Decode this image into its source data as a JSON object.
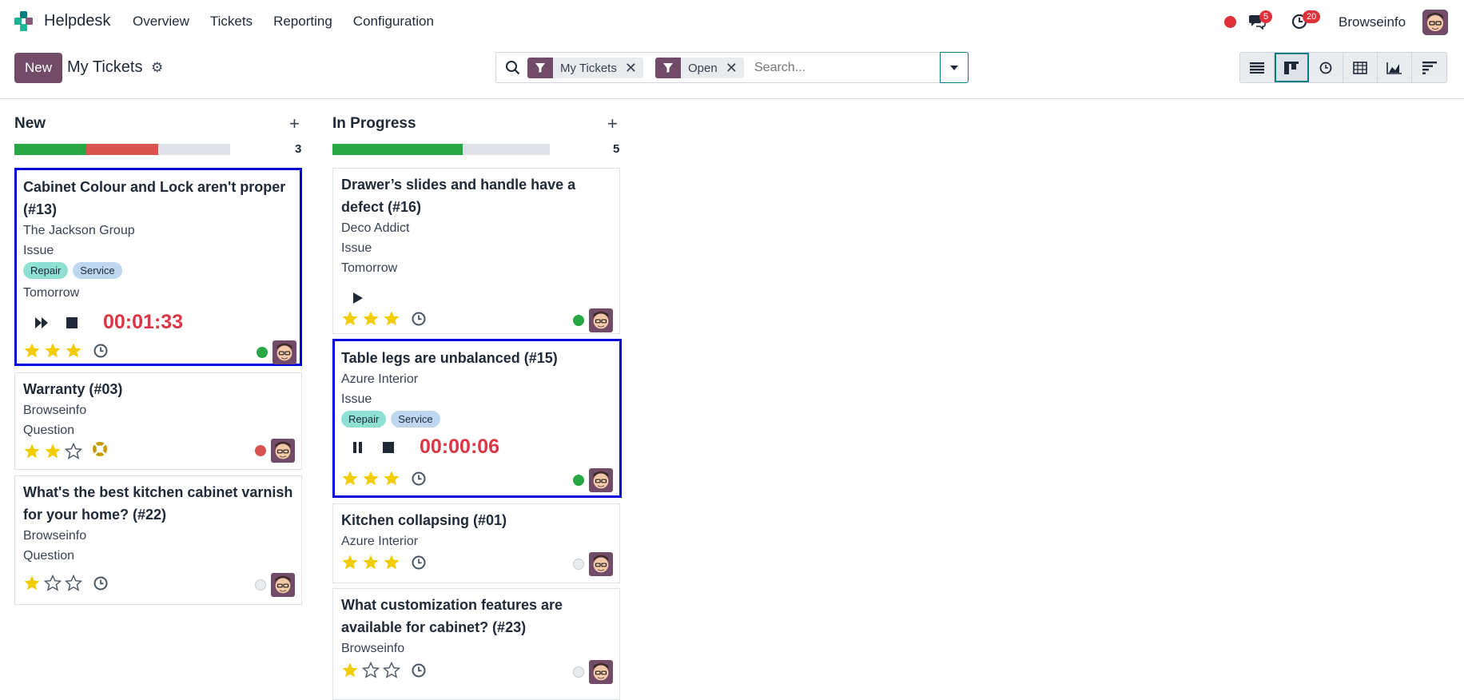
{
  "app": {
    "name": "Helpdesk",
    "menu": [
      "Overview",
      "Tickets",
      "Reporting",
      "Configuration"
    ]
  },
  "systray": {
    "messages_count": "5",
    "activities_count": "20",
    "user": "Browseinfo"
  },
  "control": {
    "new_label": "New",
    "title": "My Tickets",
    "facets": [
      "My Tickets",
      "Open"
    ],
    "search_placeholder": "Search..."
  },
  "views": [
    "list-view-icon",
    "kanban-view-icon",
    "activity-view-icon",
    "pivot-view-icon",
    "graph-view-icon",
    "cohort-view-icon"
  ],
  "colors": {
    "brand": "#714b67",
    "accent": "#017e84",
    "timer": "#dc3545"
  },
  "columns": [
    {
      "name": "New",
      "count": "3",
      "progress": {
        "green": 0.333,
        "red": 0.333
      },
      "cards": [
        {
          "title": "Cabinet Colour and Lock aren't proper (#13)",
          "customer": "The Jackson Group",
          "type": "Issue",
          "tags": [
            "Repair",
            "Service"
          ],
          "deadline": "Tomorrow",
          "timer": "00:01:33",
          "timer_state": "paused",
          "priority": 3,
          "status": "green",
          "selected": true
        },
        {
          "title": "Warranty (#03)",
          "customer": "Browseinfo",
          "type": "Question",
          "priority": 2,
          "status": "red",
          "activity": "lifebuoy"
        },
        {
          "title": "What's the best kitchen cabinet varnish for your home? (#22)",
          "customer": "Browseinfo",
          "type": "Question",
          "priority": 1,
          "status": "grey"
        }
      ]
    },
    {
      "name": "In Progress",
      "count": "5",
      "progress": {
        "green": 0.6,
        "red": 0
      },
      "cards": [
        {
          "title": "Drawer’s slides and handle have a defect (#16)",
          "customer": "Deco Addict",
          "type": "Issue",
          "deadline": "Tomorrow",
          "priority": 3,
          "status": "green"
        },
        {
          "title": "Table legs are unbalanced (#15)",
          "customer": "Azure Interior",
          "type": "Issue",
          "tags": [
            "Repair",
            "Service"
          ],
          "timer": "00:00:06",
          "timer_state": "running",
          "priority": 3,
          "status": "green",
          "selected": true
        },
        {
          "title": "Kitchen collapsing (#01)",
          "customer": "Azure Interior",
          "priority": 3,
          "status": "grey"
        },
        {
          "title": "What customization features are available for cabinet? (#23)",
          "customer": "Browseinfo",
          "priority": 1,
          "status": "grey"
        }
      ]
    }
  ]
}
